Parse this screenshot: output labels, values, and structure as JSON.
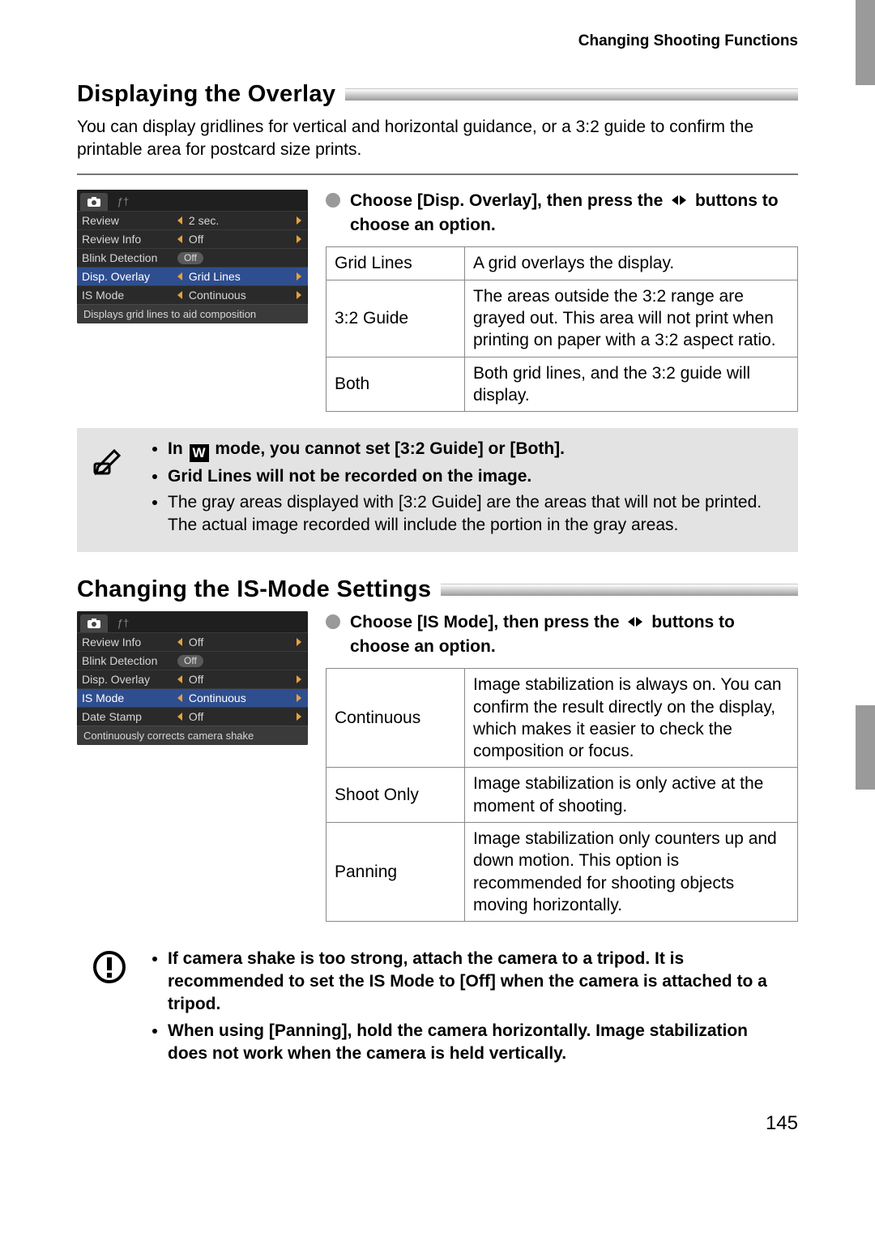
{
  "breadcrumb": "Changing Shooting Functions",
  "page_number": "145",
  "section1": {
    "title": "Displaying the Overlay",
    "lead": "You can display gridlines for vertical and horizontal guidance, or a 3:2 guide to confirm the printable area for postcard size prints.",
    "instruction_before": "Choose [Disp. Overlay], then press the ",
    "instruction_after": " buttons to choose an option.",
    "table": [
      {
        "label": "Grid Lines",
        "desc": "A grid overlays the display."
      },
      {
        "label": "3:2 Guide",
        "desc": "The areas outside the 3:2 range are grayed out. This area will not print when printing on paper with a 3:2 aspect ratio."
      },
      {
        "label": "Both",
        "desc": "Both grid lines, and the 3:2 guide will display."
      }
    ],
    "menu": {
      "help": "Displays grid lines to aid composition",
      "rows": [
        {
          "label": "Review",
          "value": "2 sec.",
          "style": "arrow"
        },
        {
          "label": "Review Info",
          "value": "Off",
          "style": "arrow"
        },
        {
          "label": "Blink Detection",
          "value": "Off",
          "style": "pill-off"
        },
        {
          "label": "Disp. Overlay",
          "value": "Grid Lines",
          "style": "selected"
        },
        {
          "label": "IS Mode",
          "value": "Continuous",
          "style": "arrow"
        }
      ]
    },
    "notes": {
      "n1_before": "In ",
      "n1_after": " mode, you cannot set [3:2 Guide] or [Both].",
      "n2": "Grid Lines will not be recorded on the image.",
      "n3": "The gray areas displayed with [3:2 Guide] are the areas that will not be printed. The actual image recorded will include the portion in the gray areas."
    }
  },
  "section2": {
    "title": "Changing the IS-Mode Settings",
    "instruction_before": "Choose [IS Mode], then press the ",
    "instruction_after": " buttons to choose an option.",
    "table": [
      {
        "label": "Continuous",
        "desc": "Image stabilization is always on. You can confirm the result directly on the display, which makes it easier to check the composition or focus."
      },
      {
        "label": "Shoot Only",
        "desc": "Image stabilization is only active at the moment of shooting."
      },
      {
        "label": "Panning",
        "desc": "Image stabilization only counters up and down motion. This option is recommended for shooting objects moving horizontally."
      }
    ],
    "menu": {
      "help": "Continuously corrects camera shake",
      "rows": [
        {
          "label": "Review Info",
          "value": "Off",
          "style": "arrow"
        },
        {
          "label": "Blink Detection",
          "value": "Off",
          "style": "pill-off"
        },
        {
          "label": "Disp. Overlay",
          "value": "Off",
          "style": "arrow"
        },
        {
          "label": "IS Mode",
          "value": "Continuous",
          "style": "selected"
        },
        {
          "label": "Date Stamp",
          "value": "Off",
          "style": "arrow"
        }
      ]
    },
    "warnings": {
      "w1": "If camera shake is too strong, attach the camera to a tripod. It is recommended to set the IS Mode to [Off] when the camera is attached to a tripod.",
      "w2": "When using [Panning], hold the camera horizontally. Image stabilization does not work when the camera is held vertically."
    }
  }
}
